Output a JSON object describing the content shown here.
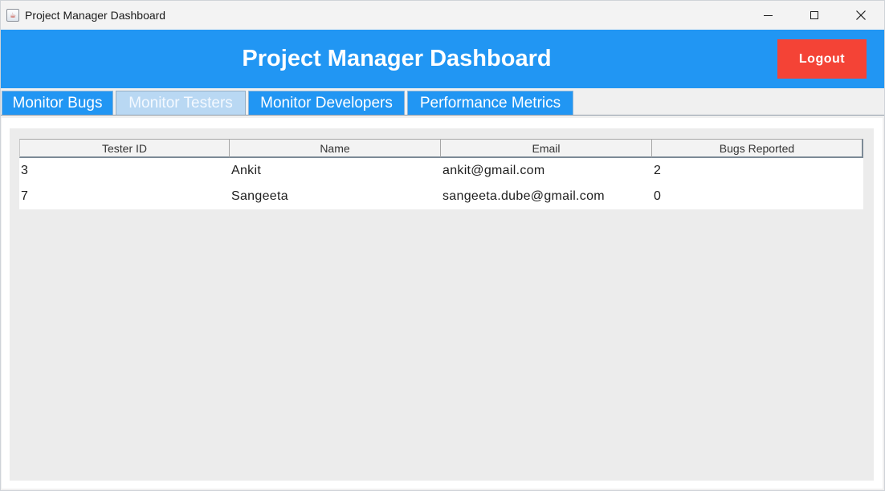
{
  "window": {
    "title": "Project Manager Dashboard",
    "icon": "java-cup-icon",
    "controls": [
      "minimize",
      "maximize",
      "close"
    ]
  },
  "header": {
    "title": "Project Manager Dashboard",
    "logout_label": "Logout",
    "bg_color": "#2196f3",
    "logout_color": "#f44336"
  },
  "tabs": [
    {
      "label": "Monitor Bugs",
      "selected": false
    },
    {
      "label": "Monitor Testers",
      "selected": true
    },
    {
      "label": "Monitor Developers",
      "selected": false
    },
    {
      "label": "Performance Metrics",
      "selected": false
    }
  ],
  "table": {
    "columns": [
      "Tester ID",
      "Name",
      "Email",
      "Bugs Reported"
    ],
    "rows": [
      [
        "3",
        "Ankit",
        "ankit@gmail.com",
        "2"
      ],
      [
        "7",
        "Sangeeta",
        "sangeeta.dube@gmail.com",
        "0"
      ]
    ]
  }
}
